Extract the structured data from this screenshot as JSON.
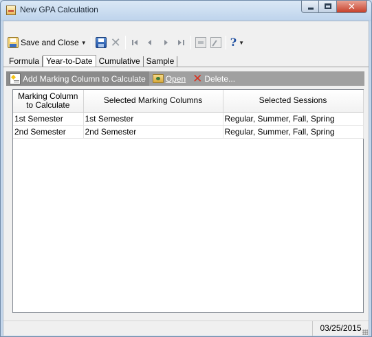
{
  "window": {
    "title": "New GPA Calculation"
  },
  "toolbar": {
    "save_close_label": "Save and Close",
    "items": [
      "save-icon",
      "delete-icon",
      "first-record-icon",
      "previous-record-icon",
      "next-record-icon",
      "last-record-icon",
      "document-icon",
      "edit-icon",
      "help-icon"
    ]
  },
  "tabs": [
    {
      "label": "Formula",
      "active": false
    },
    {
      "label": "Year-to-Date",
      "active": true
    },
    {
      "label": "Cumulative",
      "active": false
    },
    {
      "label": "Sample",
      "active": false
    }
  ],
  "actions": {
    "add_label": "Add Marking Column to Calculate",
    "open_label": "Open",
    "delete_label": "Delete..."
  },
  "grid": {
    "columns": [
      "Marking Column to Calculate",
      "Selected Marking Columns",
      "Selected Sessions"
    ],
    "rows": [
      [
        "1st Semester",
        "1st Semester",
        "Regular, Summer, Fall, Spring"
      ],
      [
        "2nd Semester",
        "2nd Semester",
        "Regular, Summer, Fall, Spring"
      ]
    ]
  },
  "status": {
    "date": "03/25/2015"
  }
}
